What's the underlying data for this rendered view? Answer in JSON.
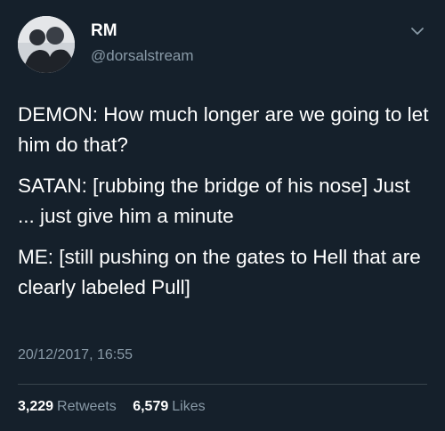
{
  "tweet": {
    "author": {
      "display_name": "RM",
      "handle": "@dorsalstream"
    },
    "menu_icon": "chevron-down-icon",
    "paragraphs": [
      "DEMON: How much longer are we going to let him do that?",
      "SATAN: [rubbing the bridge of his nose] Just ... just give him a minute",
      "ME: [still pushing on the gates to Hell that are clearly labeled Pull]"
    ],
    "timestamp": "20/12/2017, 16:55",
    "stats": {
      "retweets_count": "3,229",
      "retweets_label": "Retweets",
      "likes_count": "6,579",
      "likes_label": "Likes"
    }
  },
  "colors": {
    "background": "#15202b",
    "text": "#ffffff",
    "secondary_text": "#8899a6",
    "divider": "#38444d"
  }
}
